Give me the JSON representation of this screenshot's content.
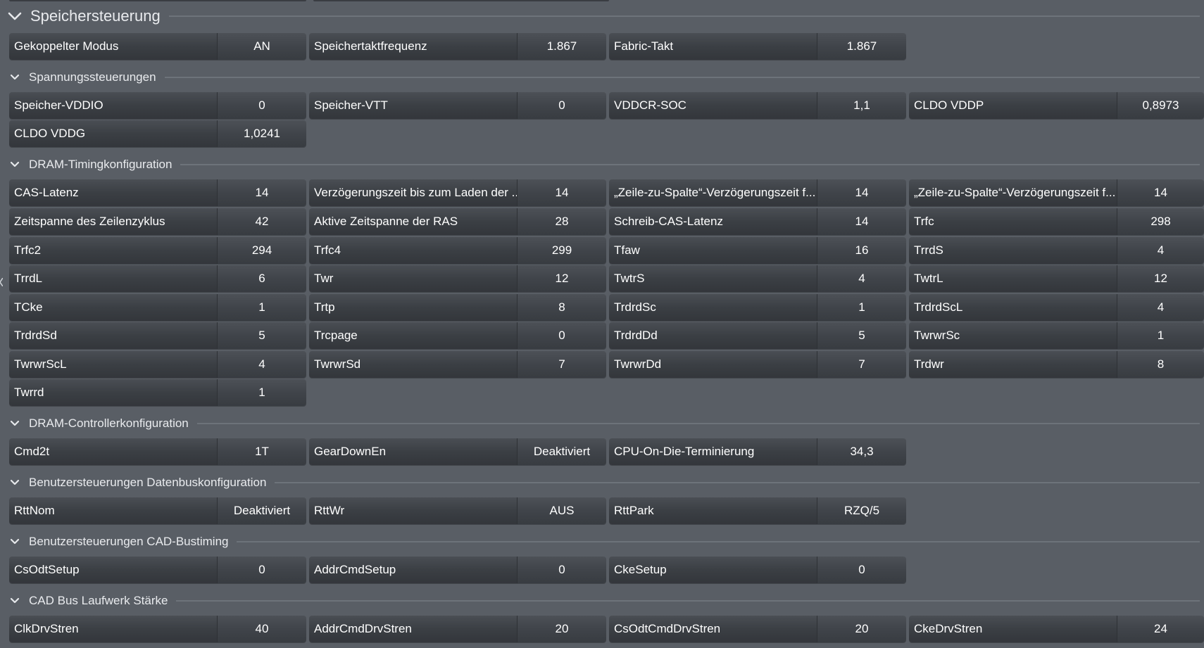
{
  "sections": {
    "main": {
      "title": "Speichersteuerung",
      "icon": "chevron-down-icon"
    },
    "top_row": [
      {
        "label": "Gekoppelter Modus",
        "value": "AN"
      },
      {
        "label": "Speichertaktfrequenz",
        "value": "1.867"
      },
      {
        "label": "Fabric-Takt",
        "value": "1.867"
      }
    ],
    "voltage": {
      "title": "Spannungssteuerungen",
      "rows": [
        [
          {
            "label": "Speicher-VDDIO",
            "value": "0"
          },
          {
            "label": "Speicher-VTT",
            "value": "0"
          },
          {
            "label": "VDDCR-SOC",
            "value": "1,1"
          },
          {
            "label": "CLDO VDDP",
            "value": "0,8973"
          }
        ],
        [
          {
            "label": "CLDO VDDG",
            "value": "1,0241"
          }
        ]
      ]
    },
    "timing": {
      "title": "DRAM-Timingkonfiguration",
      "rows": [
        [
          {
            "label": "CAS-Latenz",
            "value": "14"
          },
          {
            "label": "Verzögerungszeit bis zum Laden der ...",
            "value": "14"
          },
          {
            "label": "„Zeile-zu-Spalte“-Verzögerungszeit f...",
            "value": "14"
          },
          {
            "label": "„Zeile-zu-Spalte“-Verzögerungszeit f...",
            "value": "14"
          }
        ],
        [
          {
            "label": "Zeitspanne des Zeilenzyklus",
            "value": "42"
          },
          {
            "label": "Aktive Zeitspanne der RAS",
            "value": "28"
          },
          {
            "label": "Schreib-CAS-Latenz",
            "value": "14"
          },
          {
            "label": "Trfc",
            "value": "298"
          }
        ],
        [
          {
            "label": "Trfc2",
            "value": "294"
          },
          {
            "label": "Trfc4",
            "value": "299"
          },
          {
            "label": "Tfaw",
            "value": "16"
          },
          {
            "label": "TrrdS",
            "value": "4"
          }
        ],
        [
          {
            "label": "TrrdL",
            "value": "6"
          },
          {
            "label": "Twr",
            "value": "12"
          },
          {
            "label": "TwtrS",
            "value": "4"
          },
          {
            "label": "TwtrL",
            "value": "12"
          }
        ],
        [
          {
            "label": "TCke",
            "value": "1"
          },
          {
            "label": "Trtp",
            "value": "8"
          },
          {
            "label": "TrdrdSc",
            "value": "1"
          },
          {
            "label": "TrdrdScL",
            "value": "4"
          }
        ],
        [
          {
            "label": "TrdrdSd",
            "value": "5"
          },
          {
            "label": "Trcpage",
            "value": "0"
          },
          {
            "label": "TrdrdDd",
            "value": "5"
          },
          {
            "label": "TwrwrSc",
            "value": "1"
          }
        ],
        [
          {
            "label": "TwrwrScL",
            "value": "4"
          },
          {
            "label": "TwrwrSd",
            "value": "7"
          },
          {
            "label": "TwrwrDd",
            "value": "7"
          },
          {
            "label": "Trdwr",
            "value": "8"
          }
        ],
        [
          {
            "label": "Twrrd",
            "value": "1"
          }
        ]
      ]
    },
    "controller": {
      "title": "DRAM-Controllerkonfiguration",
      "rows": [
        [
          {
            "label": "Cmd2t",
            "value": "1T"
          },
          {
            "label": "GearDownEn",
            "value": "Deaktiviert"
          },
          {
            "label": "CPU-On-Die-Terminierung",
            "value": "34,3"
          }
        ]
      ]
    },
    "databus": {
      "title": "Benutzersteuerungen Datenbuskonfiguration",
      "rows": [
        [
          {
            "label": "RttNom",
            "value": "Deaktiviert"
          },
          {
            "label": "RttWr",
            "value": "AUS"
          },
          {
            "label": "RttPark",
            "value": "RZQ/5"
          }
        ]
      ]
    },
    "cadtiming": {
      "title": "Benutzersteuerungen CAD-Bustiming",
      "rows": [
        [
          {
            "label": "CsOdtSetup",
            "value": "0"
          },
          {
            "label": "AddrCmdSetup",
            "value": "0"
          },
          {
            "label": "CkeSetup",
            "value": "0"
          }
        ]
      ]
    },
    "cadstrength": {
      "title": "CAD Bus Laufwerk Stärke",
      "rows": [
        [
          {
            "label": "ClkDrvStren",
            "value": "40"
          },
          {
            "label": "AddrCmdDrvStren",
            "value": "20"
          },
          {
            "label": "CsOdtCmdDrvStren",
            "value": "20"
          },
          {
            "label": "CkeDrvStren",
            "value": "24"
          }
        ]
      ]
    }
  },
  "colors": {
    "background": "#595e65",
    "field_label_bg": "#3b3f44",
    "field_value_bg": "#40444a",
    "text": "#ffffff",
    "divider": "#6d737a"
  }
}
